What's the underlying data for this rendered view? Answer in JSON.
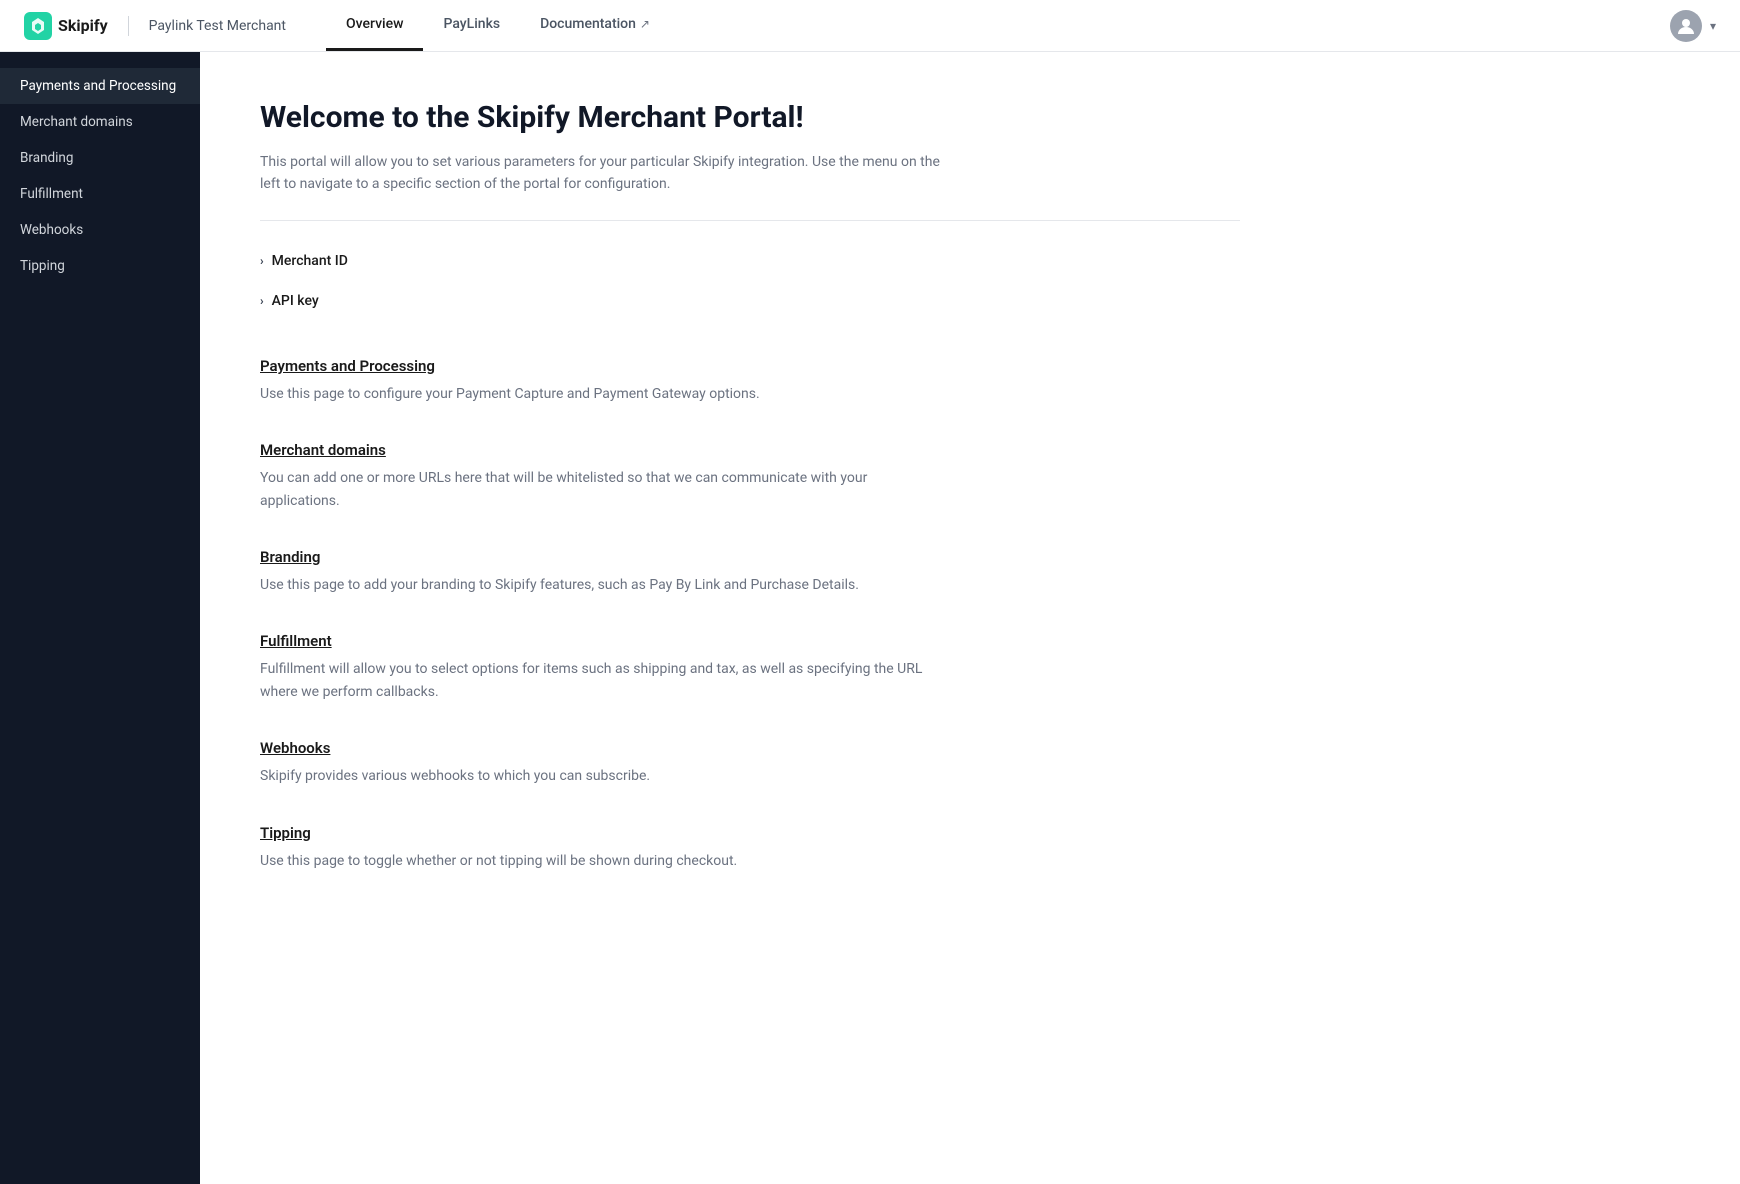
{
  "brand": {
    "logo_alt": "Skipify Logo",
    "name": "Skipify",
    "merchant": "Paylink Test Merchant"
  },
  "nav": {
    "tabs": [
      {
        "label": "Overview",
        "active": true,
        "external": false
      },
      {
        "label": "PayLinks",
        "active": false,
        "external": false
      },
      {
        "label": "Documentation",
        "active": false,
        "external": true
      }
    ]
  },
  "sidebar": {
    "items": [
      {
        "label": "Payments and Processing",
        "active": true
      },
      {
        "label": "Merchant domains",
        "active": false
      },
      {
        "label": "Branding",
        "active": false
      },
      {
        "label": "Fulfillment",
        "active": false
      },
      {
        "label": "Webhooks",
        "active": false
      },
      {
        "label": "Tipping",
        "active": false
      }
    ]
  },
  "main": {
    "title": "Welcome to the Skipify Merchant Portal!",
    "subtitle": "This portal will allow you to set various parameters for your particular Skipify integration. Use the menu on the left to navigate to a specific section of the portal for configuration.",
    "accordion": [
      {
        "label": "Merchant ID"
      },
      {
        "label": "API key"
      }
    ],
    "sections": [
      {
        "title": "Payments and Processing",
        "description": "Use this page to configure your Payment Capture and Payment Gateway options."
      },
      {
        "title": "Merchant domains",
        "description": "You can add one or more URLs here that will be whitelisted so that we can communicate with your applications."
      },
      {
        "title": "Branding",
        "description": "Use this page to add your branding to Skipify features, such as Pay By Link and Purchase Details."
      },
      {
        "title": "Fulfillment",
        "description": "Fulfillment will allow you to select options for items such as shipping and tax, as well as specifying the URL where we perform callbacks."
      },
      {
        "title": "Webhooks",
        "description": "Skipify provides various webhooks to which you can subscribe."
      },
      {
        "title": "Tipping",
        "description": "Use this page to toggle whether or not tipping will be shown during checkout."
      }
    ]
  }
}
